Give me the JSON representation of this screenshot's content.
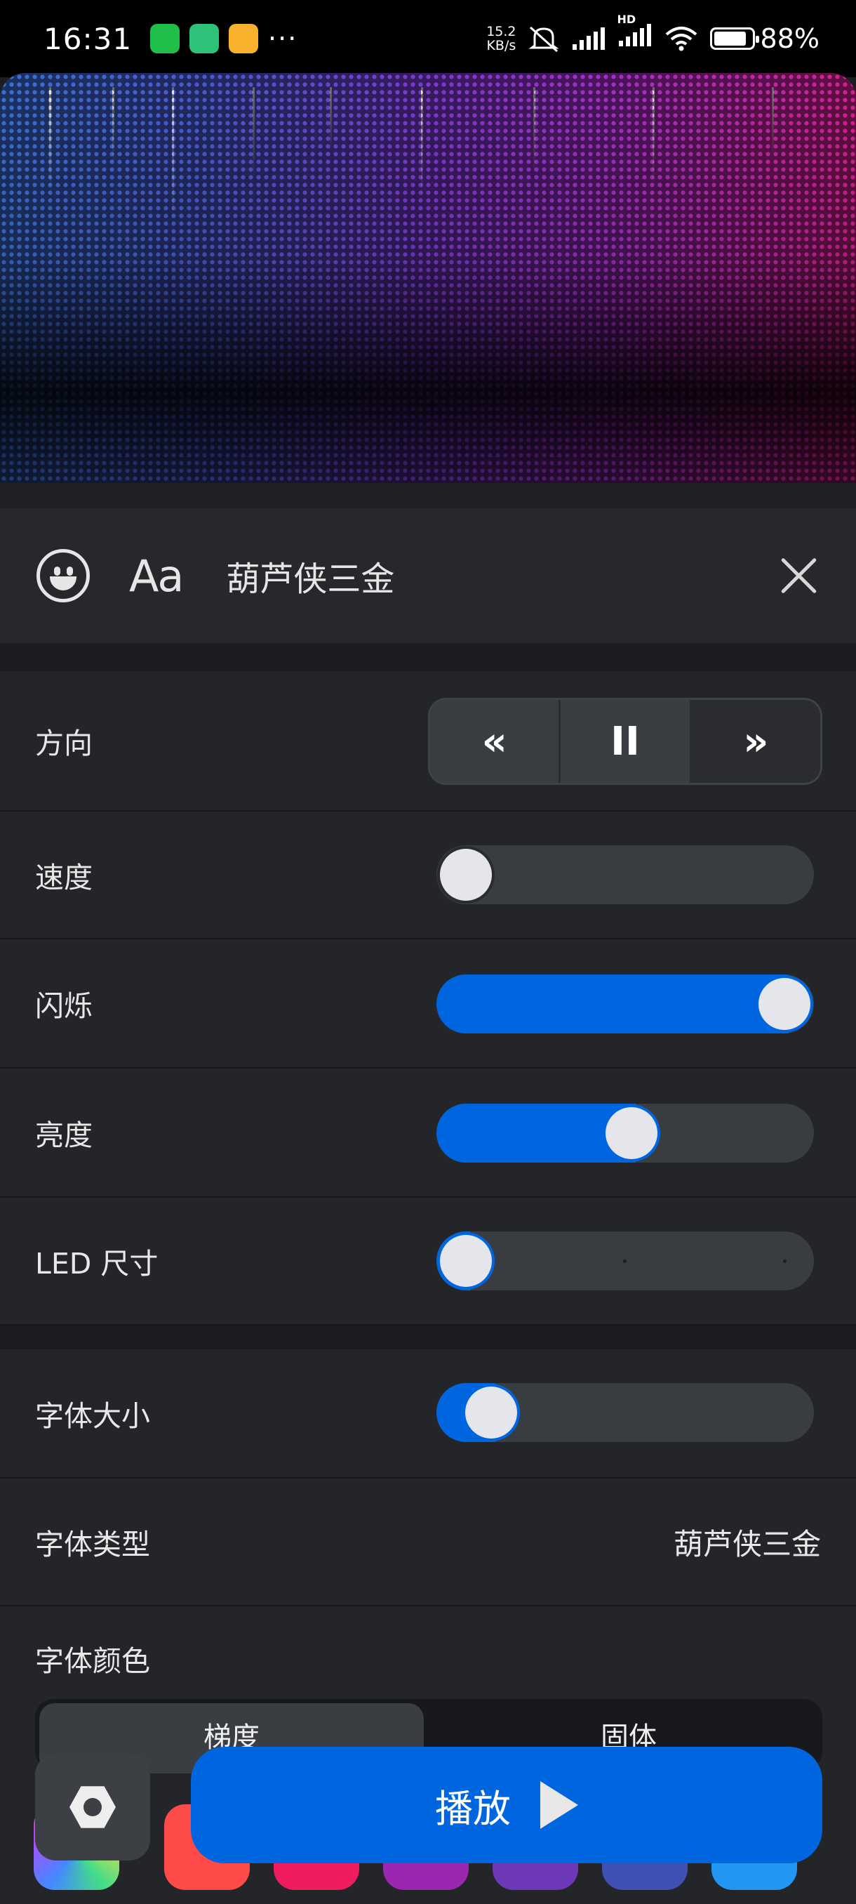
{
  "status_bar": {
    "time": "16:31",
    "more": "···",
    "net_speed_value": "15.2",
    "net_speed_unit": "KB/s",
    "hd_badge": "HD",
    "battery_level": 0.88,
    "battery_text": "88%"
  },
  "text_bar": {
    "font_icon_label": "Aa",
    "text_value": "葫芦侠三金"
  },
  "direction": {
    "label": "方向",
    "left_symbol": "«",
    "pause_symbol": "II",
    "right_symbol": "»"
  },
  "speed": {
    "label": "速度",
    "value": 0.0
  },
  "blink": {
    "label": "闪烁",
    "value": 1.0
  },
  "brightness": {
    "label": "亮度",
    "value": 0.52
  },
  "led_size": {
    "label": "LED 尺寸",
    "value": 0.0
  },
  "font_size": {
    "label": "字体大小",
    "value": 0.08
  },
  "font_type": {
    "label": "字体类型",
    "value": "葫芦侠三金"
  },
  "font_color": {
    "label": "字体颜色",
    "tabs": [
      {
        "label": "梯度",
        "selected": true
      },
      {
        "label": "固体",
        "selected": false
      }
    ],
    "swatches": [
      "#ff4a4a",
      "#ef1c5f",
      "#9b27b0",
      "#6d38b8",
      "#3f51b5",
      "#2196f3"
    ]
  },
  "play_button": {
    "label": "播放"
  },
  "colors": {
    "accent": "#0066e0",
    "panel": "#232528",
    "background": "#1b1d20"
  }
}
